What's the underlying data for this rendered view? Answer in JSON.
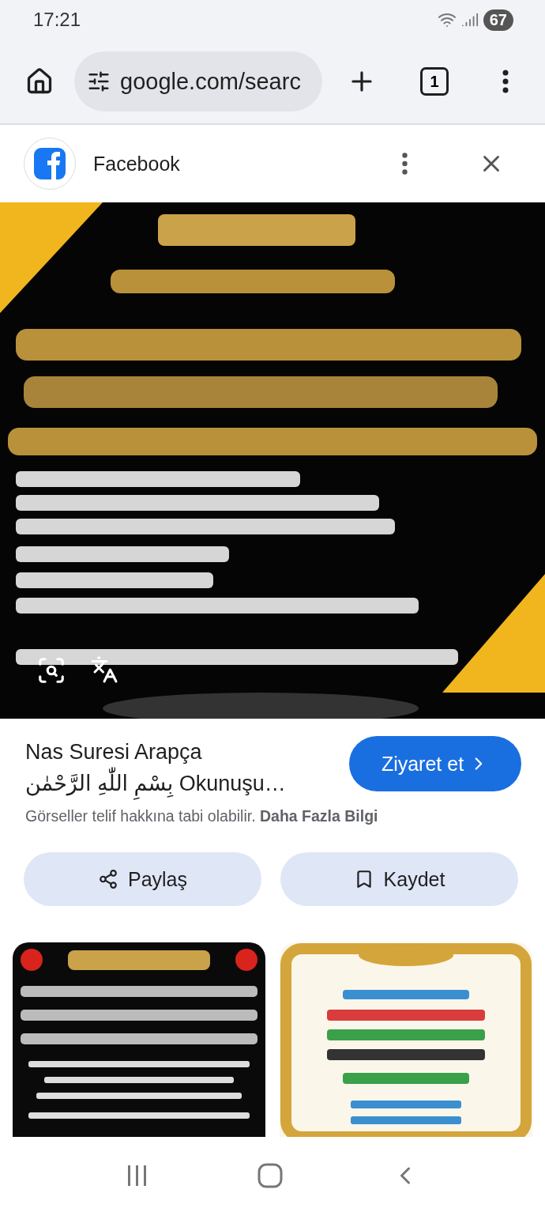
{
  "status_bar": {
    "time": "17:21",
    "battery": "67"
  },
  "browser": {
    "url": "google.com/searc",
    "tab_count": "1"
  },
  "source": {
    "name": "Facebook"
  },
  "result": {
    "title_lines": [
      "Nas Suresi Arapça",
      "بِسْمِ اللّٰهِ الرَّحْمٰن Okunuşu…"
    ],
    "visit_button": "Ziyaret et",
    "notice": "Görseller telif hakkına tabi olabilir.",
    "more_link": "Daha Fazla Bilgi"
  },
  "actions": [
    {
      "kind": "share",
      "label": "Paylaş"
    },
    {
      "kind": "save",
      "label": "Kaydet"
    }
  ],
  "related": [
    {
      "kind": "dark"
    },
    {
      "kind": "light"
    }
  ]
}
